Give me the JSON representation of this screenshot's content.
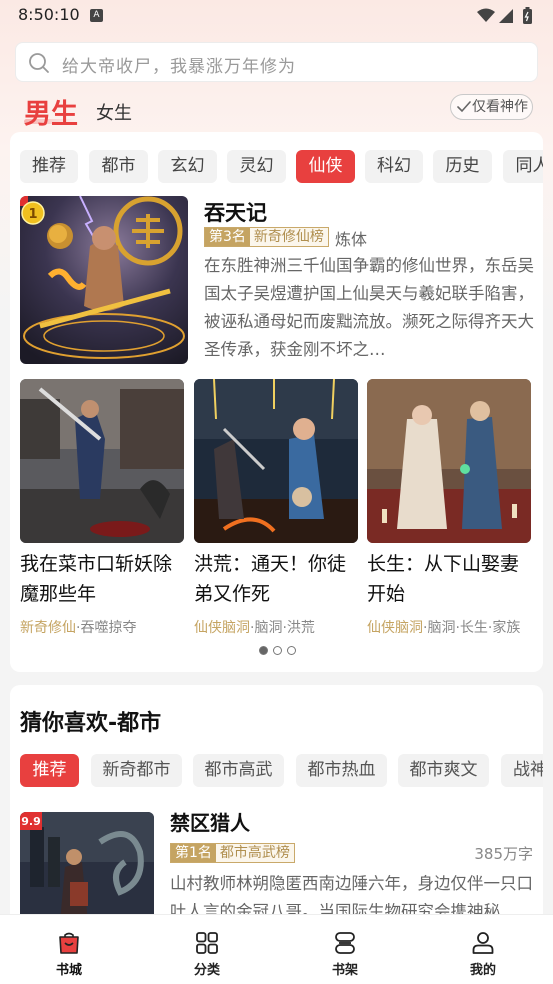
{
  "status_bar": {
    "time": "8:50:10",
    "notif_letter": "A"
  },
  "search": {
    "placeholder": "给大帝收尸，我暴涨万年修为"
  },
  "gender_tabs": {
    "male": "男生",
    "female": "女生"
  },
  "filter_toggle": {
    "label": "仅看神作",
    "icon": "check-icon"
  },
  "category_chips": [
    {
      "label": "推荐",
      "active": false
    },
    {
      "label": "都市",
      "active": false
    },
    {
      "label": "玄幻",
      "active": false
    },
    {
      "label": "灵幻",
      "active": false
    },
    {
      "label": "仙侠",
      "active": true
    },
    {
      "label": "科幻",
      "active": false
    },
    {
      "label": "历史",
      "active": false
    },
    {
      "label": "同人",
      "active": false
    }
  ],
  "featured": {
    "rank_badge": "1",
    "title": "吞天记",
    "rank_num": "第3名",
    "rank_list": "新奇修仙榜",
    "tag": "炼体",
    "description": "在东胜神洲三千仙国争霸的修仙世界，东岳吴国太子吴煜遭护国上仙昊天与羲妃联手陷害，被诬私通母妃而废黜流放。濒死之际得齐天大圣传承，获金刚不坏之…"
  },
  "mini_books": [
    {
      "title": "我在菜市口斩妖除魔那些年",
      "tag_hl": "新奇修仙",
      "tags": "·吞噬掠夺"
    },
    {
      "title": "洪荒：通天！你徒弟又作死",
      "tag_hl": "仙侠脑洞",
      "tags": "·脑洞·洪荒"
    },
    {
      "title": "长生：从下山娶妻开始",
      "tag_hl": "仙侠脑洞",
      "tags": "·脑洞·长生·家族"
    }
  ],
  "carousel": {
    "pages": 3,
    "current": 1
  },
  "guess_section": {
    "title": "猜你喜欢-都市",
    "chips": [
      {
        "label": "推荐",
        "active": true
      },
      {
        "label": "新奇都市",
        "active": false
      },
      {
        "label": "都市高武",
        "active": false
      },
      {
        "label": "都市热血",
        "active": false
      },
      {
        "label": "都市爽文",
        "active": false
      },
      {
        "label": "战神",
        "active": false
      }
    ],
    "book": {
      "score": "9.9",
      "title": "禁区猎人",
      "rank_num": "第1名",
      "rank_list": "都市高武榜",
      "words": "385万字",
      "description": "山村教师林朔隐匿西南边陲六年，身边仅伴一只口吐人言的金冠八哥。当国际生物研究会携神秘"
    }
  },
  "tabbar": [
    {
      "label": "书城",
      "icon": "bookstore-icon",
      "active": true
    },
    {
      "label": "分类",
      "icon": "category-grid-icon",
      "active": false
    },
    {
      "label": "书架",
      "icon": "bookshelf-icon",
      "active": false
    },
    {
      "label": "我的",
      "icon": "profile-icon",
      "active": false
    }
  ],
  "colors": {
    "accent": "#e8403f",
    "gold": "#c5a462"
  }
}
